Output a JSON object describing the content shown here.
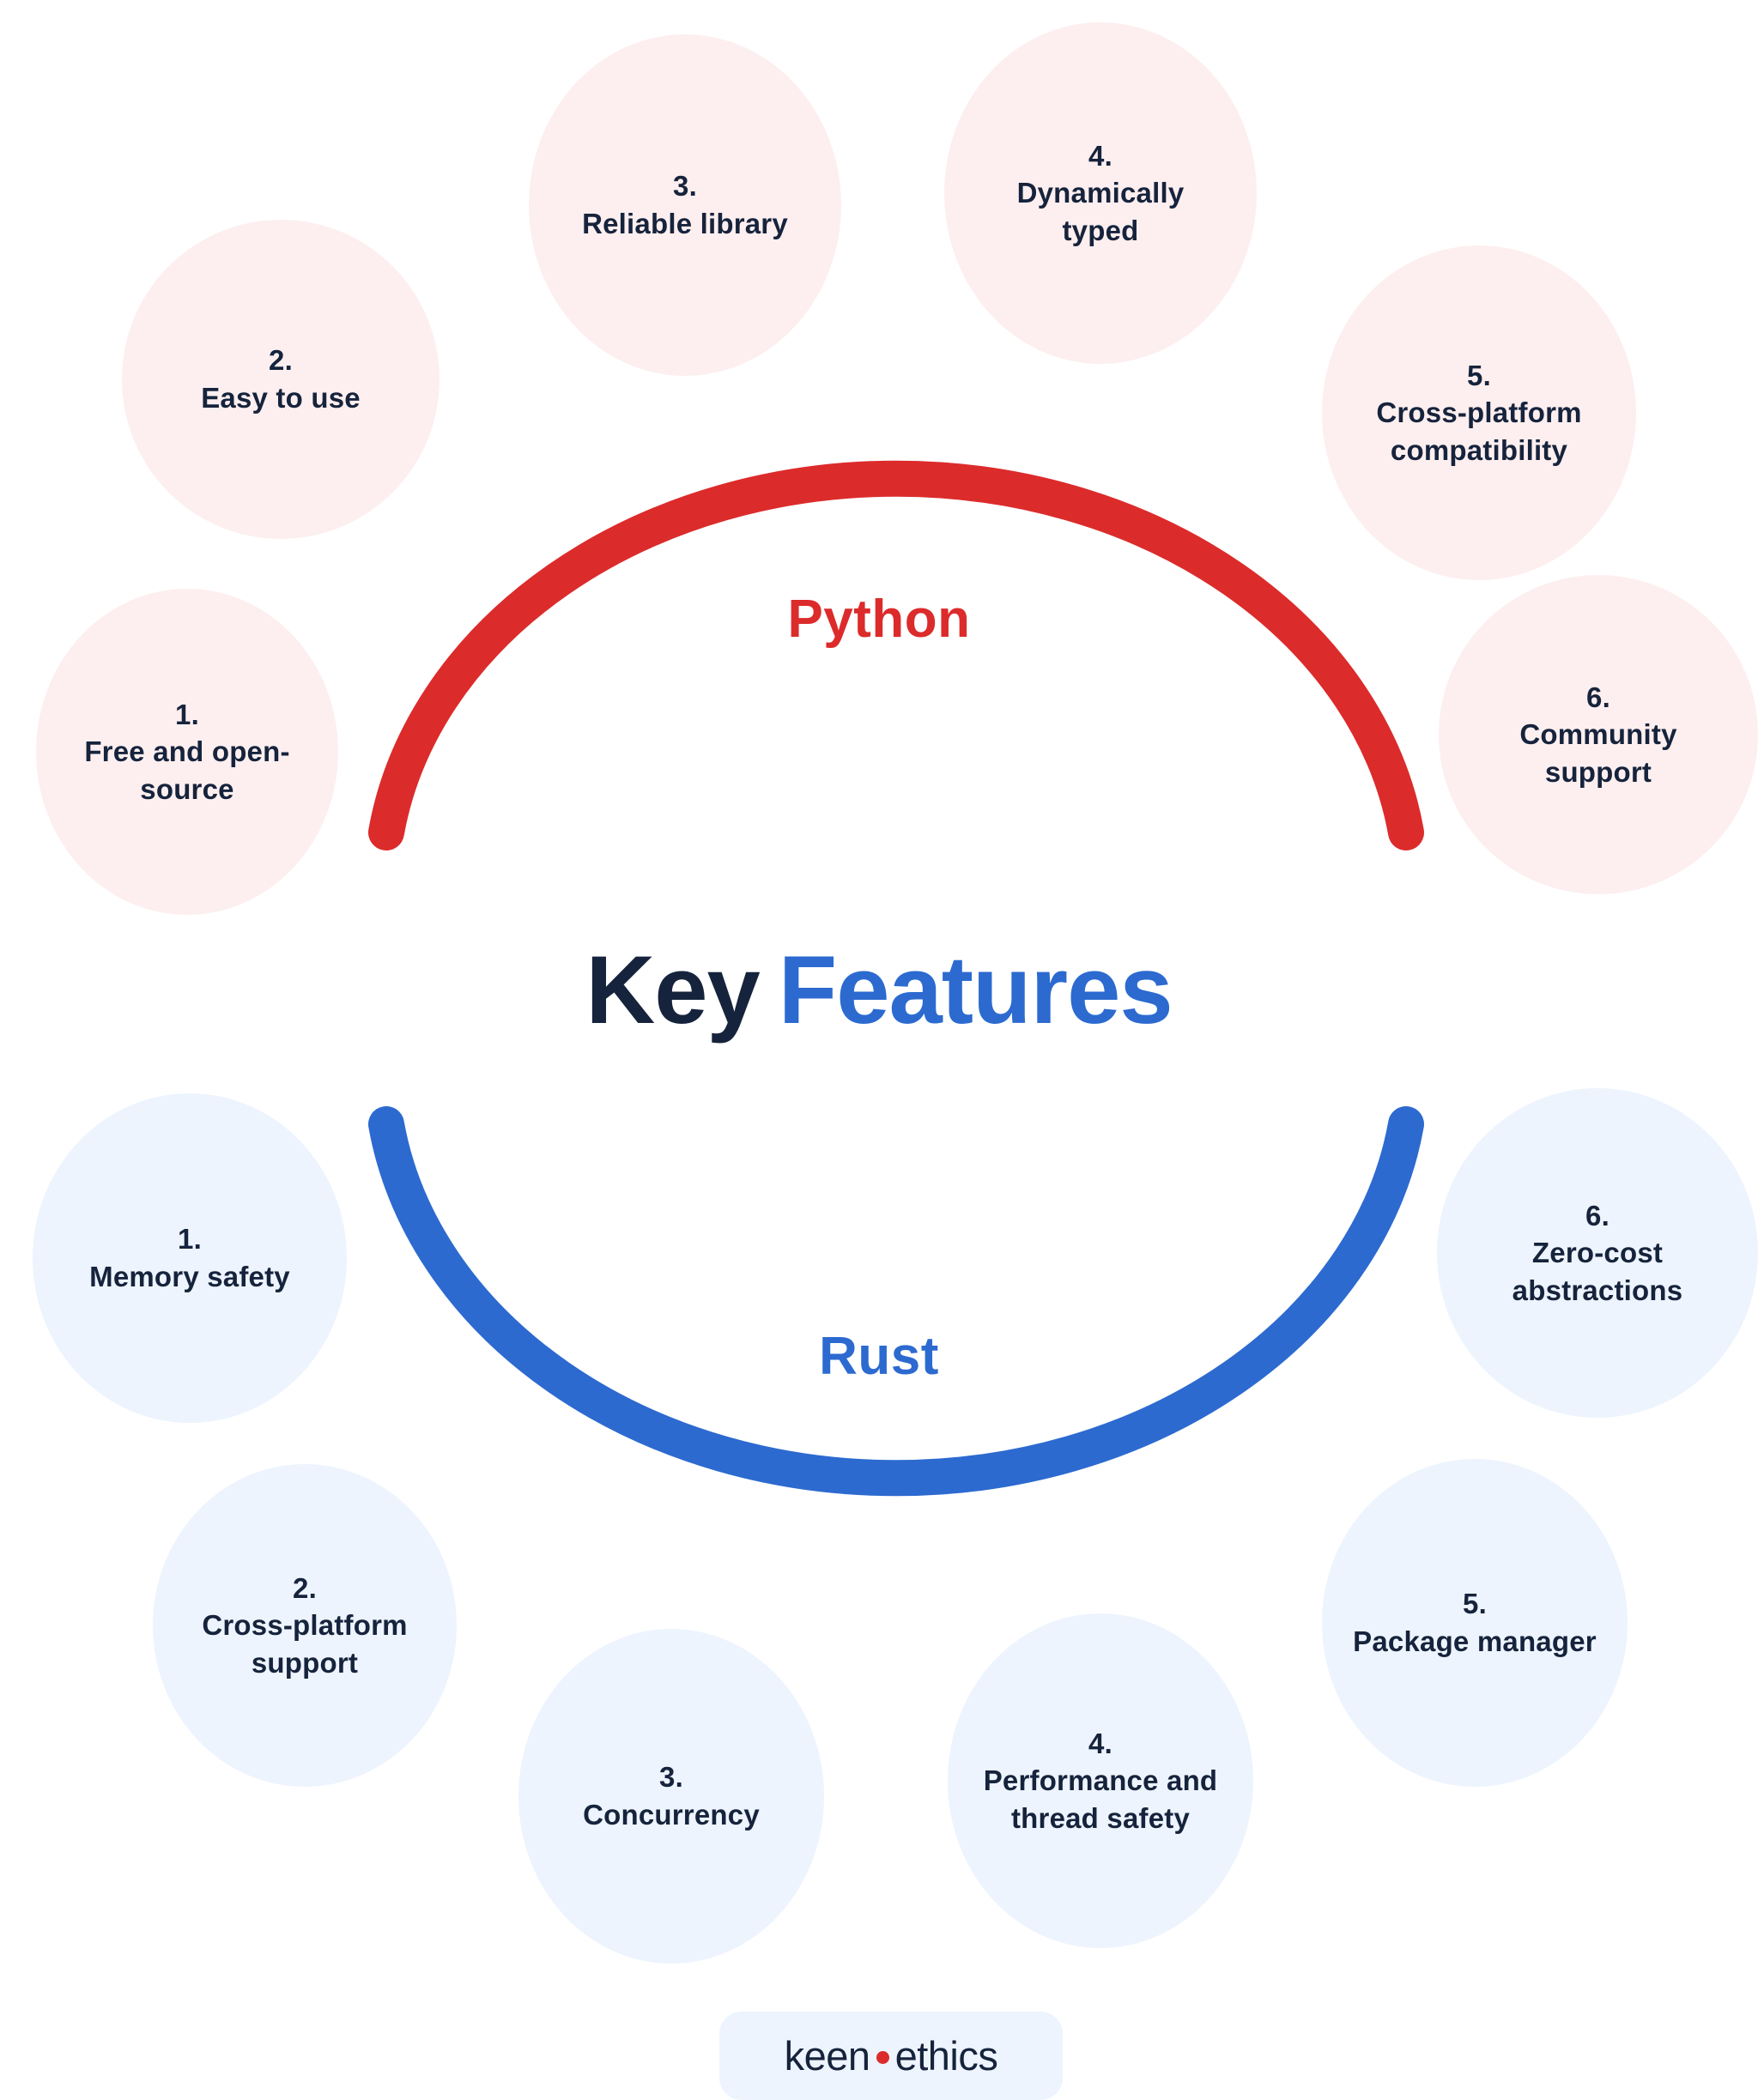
{
  "title": {
    "part1": "Key",
    "part2": "Features"
  },
  "colors": {
    "python_accent": "#DC2B2B",
    "rust_accent": "#2C6AD0",
    "python_bubble_bg": "#FDEFEF",
    "rust_bubble_bg": "#EDF4FD",
    "text_dark": "#16233C",
    "page_bg": "#FFFFFF"
  },
  "sections": [
    {
      "id": "python",
      "label": "Python",
      "accent": "#DC2B2B",
      "features": [
        {
          "num": "1.",
          "label": "Free and open-\nsource"
        },
        {
          "num": "2.",
          "label": "Easy to use"
        },
        {
          "num": "3.",
          "label": "Reliable library"
        },
        {
          "num": "4.",
          "label": "Dynamically\ntyped"
        },
        {
          "num": "5.",
          "label": "Cross-platform\ncompatibility"
        },
        {
          "num": "6.",
          "label": "Community\nsupport"
        }
      ]
    },
    {
      "id": "rust",
      "label": "Rust",
      "accent": "#2C6AD0",
      "features": [
        {
          "num": "1.",
          "label": "Memory safety"
        },
        {
          "num": "2.",
          "label": "Cross-platform\nsupport"
        },
        {
          "num": "3.",
          "label": "Concurrency"
        },
        {
          "num": "4.",
          "label": "Performance and\nthread safety"
        },
        {
          "num": "5.",
          "label": "Package manager"
        },
        {
          "num": "6.",
          "label": "Zero-cost\nabstractions"
        }
      ]
    }
  ],
  "footer": {
    "logo_part1": "keen",
    "logo_part2": "ethics",
    "logo_dot_color": "#DC2B2B"
  },
  "chart_data": {
    "type": "diagram",
    "diagram_style": "two-arc radial feature map",
    "title": "Key Features",
    "groups": [
      {
        "name": "Python",
        "color": "#DC2B2B",
        "arc": "upper semicircle, opens downward",
        "items": [
          "1. Free and open-source",
          "2. Easy to use",
          "3. Reliable library",
          "4. Dynamically typed",
          "5. Cross-platform compatibility",
          "6. Community support"
        ]
      },
      {
        "name": "Rust",
        "color": "#2C6AD0",
        "arc": "lower semicircle, opens upward",
        "items": [
          "1. Memory safety",
          "2. Cross-platform support",
          "3. Concurrency",
          "4. Performance and thread safety",
          "5. Package manager",
          "6. Zero-cost abstractions"
        ]
      }
    ]
  }
}
